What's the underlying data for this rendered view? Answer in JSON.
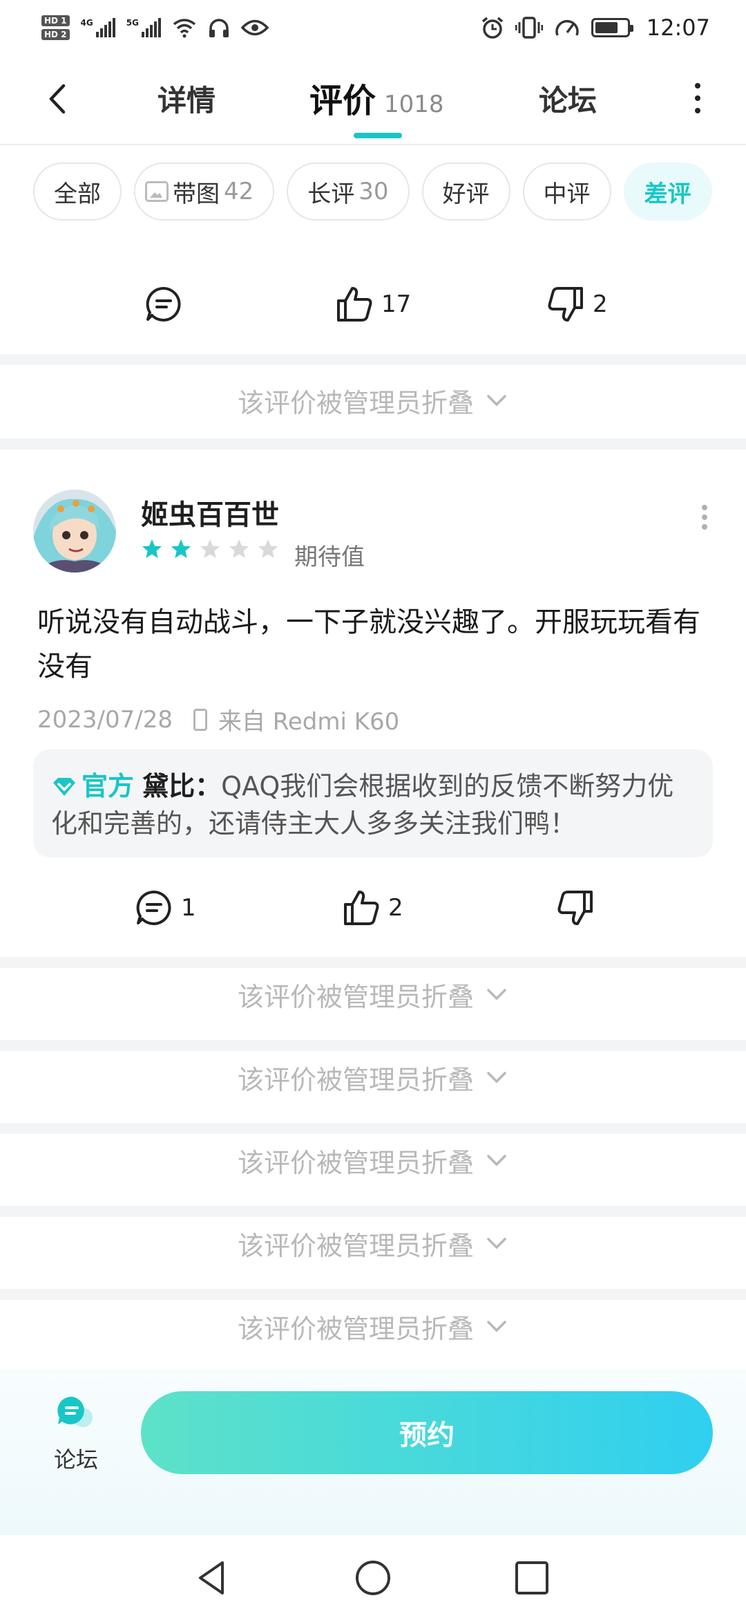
{
  "status_bar": {
    "hd1": "HD 1",
    "hd2": "HD 2",
    "net1": "4G",
    "net2": "5G",
    "time": "12:07"
  },
  "header": {
    "tab_detail": "详情",
    "tab_reviews": "评价",
    "review_count": "1018",
    "tab_forum": "论坛"
  },
  "filters": [
    {
      "label": "全部",
      "count": ""
    },
    {
      "label": "带图",
      "count": "42"
    },
    {
      "label": "长评",
      "count": "30"
    },
    {
      "label": "好评",
      "count": ""
    },
    {
      "label": "中评",
      "count": ""
    },
    {
      "label": "差评",
      "count": ""
    }
  ],
  "first_actions": {
    "comment_count": "",
    "like_count": "17",
    "dislike_count": "2"
  },
  "folded_text": "该评价被管理员折叠",
  "review": {
    "username": "姬虫百百世",
    "rating_filled": 2,
    "rating_total": 5,
    "rating_label": "期待值",
    "text": "听说没有自动战斗，一下子就没兴趣了。开服玩玩看有没有",
    "date": "2023/07/28",
    "device": "来自 Redmi K60",
    "reply": {
      "badge": "官方",
      "author": "黛比",
      "separator": "：",
      "text": "QAQ我们会根据收到的反馈不断努力优化和完善的，还请侍主大人多多关注我们鸭！"
    },
    "comment_count": "1",
    "like_count": "2",
    "dislike_count": ""
  },
  "bottom": {
    "forum_label": "论坛",
    "reserve_label": "预约"
  },
  "colors": {
    "accent": "#18c6c6",
    "star_on": "#18c6c6",
    "star_off": "#d9d9d9"
  }
}
